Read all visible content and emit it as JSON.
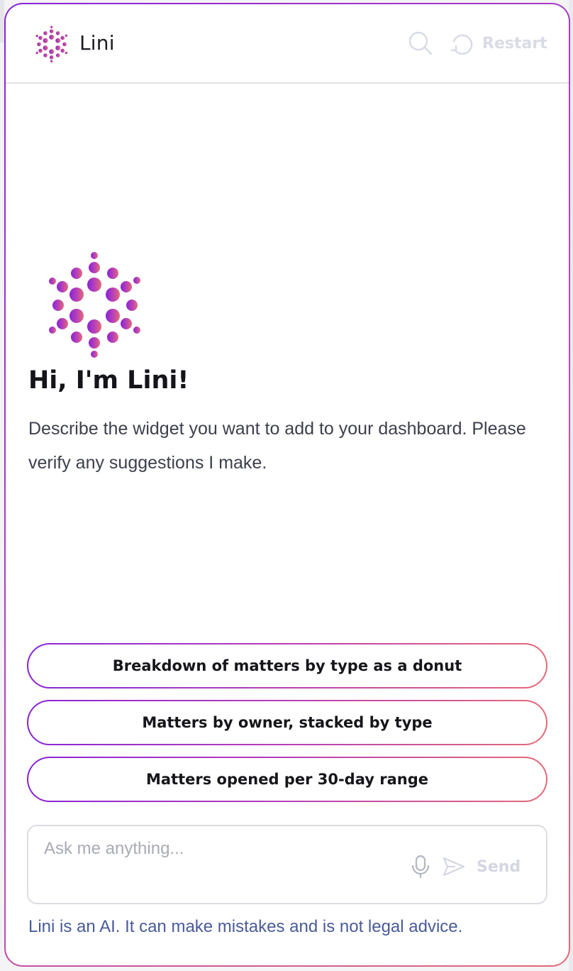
{
  "header": {
    "title": "Lini",
    "restart_label": "Restart"
  },
  "hero": {
    "greeting": "Hi, I'm Lini!",
    "intro": "Describe the widget you want to add to your dashboard. Please verify any suggestions I make."
  },
  "suggestions": [
    {
      "label": "Breakdown of matters by type as a donut"
    },
    {
      "label": "Matters by owner, stacked by type"
    },
    {
      "label": "Matters opened per 30-day range"
    }
  ],
  "composer": {
    "placeholder": "Ask me anything...",
    "send_label": "Send"
  },
  "footer": {
    "disclaimer": "Lini is an AI. It can make mistakes and is not legal advice."
  },
  "icons": {
    "logo": "lini-logo-icon",
    "search": "search-icon",
    "restart": "restart-icon",
    "mic": "microphone-icon",
    "send": "send-icon"
  },
  "colors": {
    "gradient_start": "#8a24d6",
    "gradient_end": "#e46a78",
    "disclaimer": "#4a5b9a",
    "disabled": "#d4d6e2"
  }
}
